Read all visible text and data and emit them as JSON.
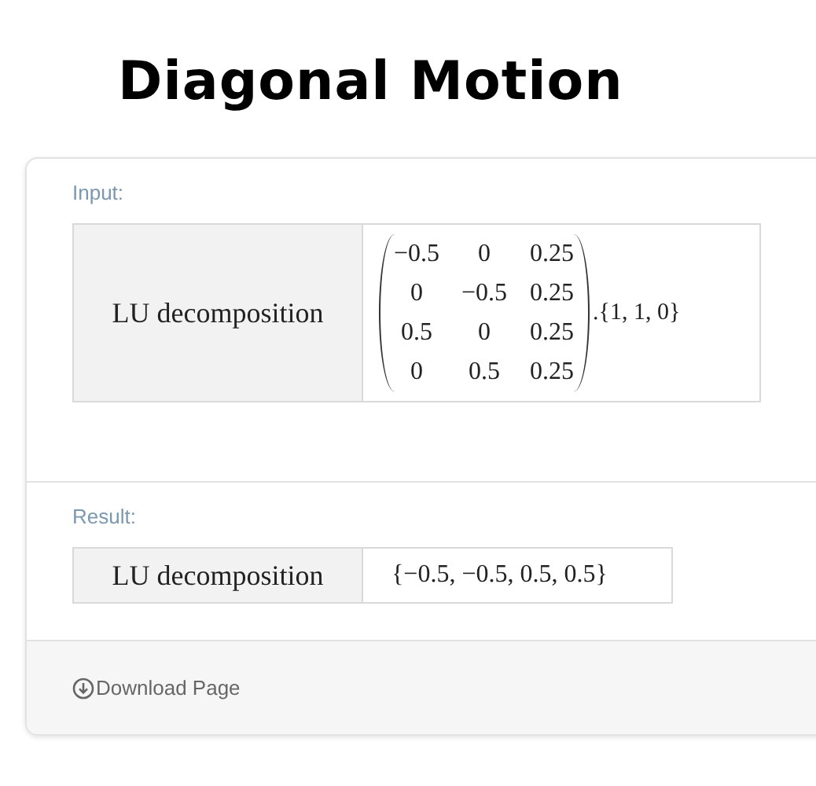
{
  "title": "Diagonal Motion",
  "input": {
    "label": "Input:",
    "operation": "LU decomposition",
    "matrix": [
      [
        "−0.5",
        "0",
        "0.25"
      ],
      [
        "0",
        "−0.5",
        "0.25"
      ],
      [
        "0.5",
        "0",
        "0.25"
      ],
      [
        "0",
        "0.5",
        "0.25"
      ]
    ],
    "vector": ".{1, 1, 0}"
  },
  "result": {
    "label": "Result:",
    "operation": "LU decomposition",
    "value": "{−0.5, −0.5, 0.5, 0.5}"
  },
  "footer": {
    "download": "Download Page"
  }
}
